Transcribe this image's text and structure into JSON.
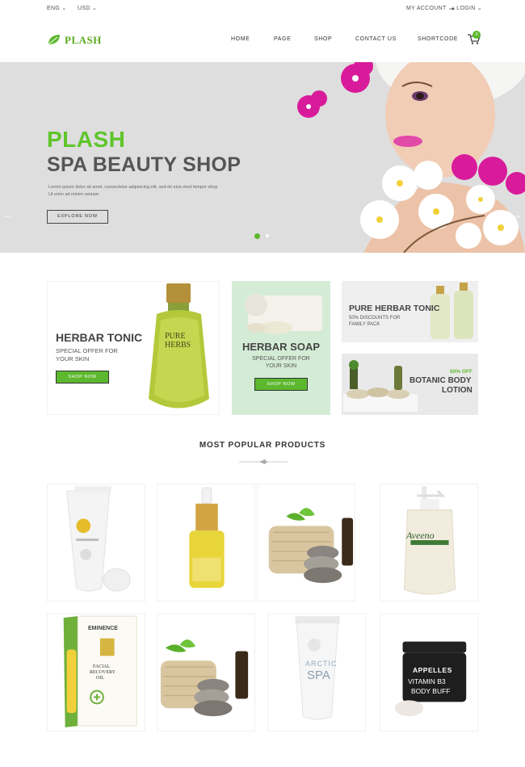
{
  "topbar": {
    "language": "ENG",
    "currency": "USD",
    "account": "MY ACCOUNT",
    "login": "LOGIN"
  },
  "header": {
    "logo": "PLASH",
    "nav": [
      "HOME",
      "PAGE",
      "SHOP",
      "CONTACT US",
      "SHORTCODE"
    ],
    "cart_count": "0"
  },
  "hero": {
    "title_line1": "PLASH",
    "title_line2": "SPA BEAUTY SHOP",
    "description": "Lorem ipsum dolor sit amet, consectetur adipisicing elit, sed do eius-mod tempor shop Ut enim ad minim veniam.",
    "button": "EXPLORE NOW"
  },
  "banners": {
    "tonic": {
      "title": "HERBAR TONIC",
      "sub1": "SPECIAL OFFER FOR",
      "sub2": "YOUR SKIN",
      "button": "SHOP NOW",
      "bottle_line1": "PURE",
      "bottle_line2": "HERBS"
    },
    "soap": {
      "title": "HERBAR SOAP",
      "sub1": "SPECIAL OFFER FOR",
      "sub2": "YOUR SKIN",
      "button": "SHOP NOW"
    },
    "pure_tonic": {
      "title": "PURE HERBAR TONIC",
      "sub1": "50% DISCOUNTS FOR",
      "sub2": "FAMILY PACK"
    },
    "botanic": {
      "badge": "50% OFF",
      "title1": "BOTANIC BODY",
      "title2": "LOTION"
    }
  },
  "section": {
    "title": "MOST POPULAR PRODUCTS"
  },
  "products": {
    "p3": {
      "brand": "Aveeno"
    },
    "p4": {
      "brand": "EMINENCE",
      "line1": "FACIAL",
      "line2": "RECOVERY",
      "line3": "OIL"
    },
    "p6": {
      "line1": "ARCTIC",
      "line2": "SPA"
    },
    "p7": {
      "brand": "APPELLES",
      "line1": "VITAMIN B3",
      "line2": "BODY BUFF"
    }
  },
  "colors": {
    "accent": "#5cb82e",
    "hero_bg": "#dedede",
    "soap_bg": "#d4ecd6"
  }
}
